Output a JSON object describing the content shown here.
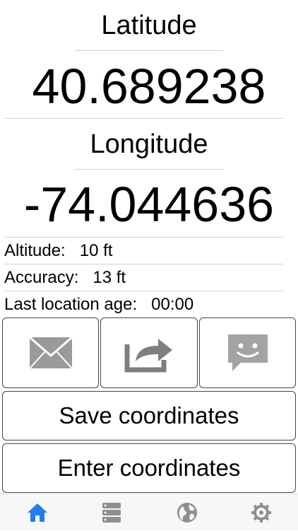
{
  "latitude": {
    "label": "Latitude",
    "value": "40.689238"
  },
  "longitude": {
    "label": "Longitude",
    "value": "-74.044636"
  },
  "details": {
    "altitude": {
      "label": "Altitude:",
      "value": "10 ft"
    },
    "accuracy": {
      "label": "Accuracy:",
      "value": "13 ft"
    },
    "location_age": {
      "label": "Last location age:",
      "value": "00:00"
    }
  },
  "share_buttons": [
    {
      "icon": "mail-icon"
    },
    {
      "icon": "share-icon"
    },
    {
      "icon": "message-icon"
    }
  ],
  "actions": {
    "save": "Save coordinates",
    "enter": "Enter coordinates"
  },
  "tabs": [
    {
      "icon": "home-icon",
      "active": true
    },
    {
      "icon": "list-icon",
      "active": false
    },
    {
      "icon": "globe-icon",
      "active": false
    },
    {
      "icon": "gear-icon",
      "active": false
    }
  ],
  "colors": {
    "tab_active": "#1f7ee8",
    "tab_inactive": "#8e8e93",
    "icon_gray": "#8a8a8a"
  }
}
